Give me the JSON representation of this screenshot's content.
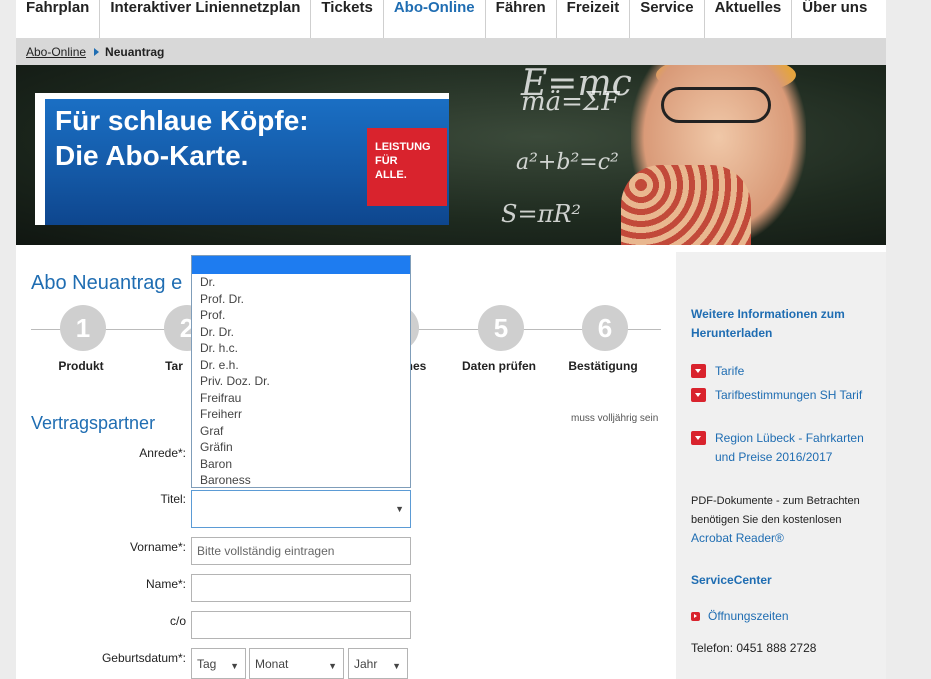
{
  "nav": {
    "items": [
      "Fahrplan",
      "Interaktiver Liniennetzplan",
      "Tickets",
      "Abo-Online",
      "Fähren",
      "Freizeit",
      "Service",
      "Aktuelles",
      "Über uns"
    ],
    "active": "Abo-Online"
  },
  "breadcrumb": {
    "link": "Abo-Online",
    "current": "Neuantrag"
  },
  "banner": {
    "line1": "Für schlaue Köpfe:",
    "line2": "Die Abo-Karte.",
    "badge": [
      "LEISTUNG",
      "FÜR",
      "ALLE."
    ],
    "chalk": [
      "E=mc",
      "mä=ΣF",
      "a²+b²=c²",
      "S=πR²"
    ]
  },
  "main": {
    "title": "Abo Neuantrag e",
    "steps": [
      {
        "num": "1",
        "label": "Produkt"
      },
      {
        "num": "2",
        "label": "Tar"
      },
      {
        "num": "4",
        "label": "nes"
      },
      {
        "num": "5",
        "label": "Daten prüfen"
      },
      {
        "num": "6",
        "label": "Bestätigung"
      }
    ],
    "section": "Vertragspartner",
    "note": "muss volljährig sein",
    "form": {
      "anrede_label": "Anrede*:",
      "titel_label": "Titel:",
      "vorname_label": "Vorname*:",
      "vorname_placeholder": "Bitte vollständig eintragen",
      "name_label": "Name*:",
      "co_label": "c/o",
      "geburt_label": "Geburtsdatum*:",
      "tag": "Tag",
      "monat": "Monat",
      "jahr": "Jahr"
    },
    "titel_options": [
      "Dr.",
      "Prof. Dr.",
      "Prof.",
      "Dr. Dr.",
      "Dr. h.c.",
      "Dr. e.h.",
      "Priv. Doz. Dr.",
      "Freifrau",
      "Freiherr",
      "Graf",
      "Gräfin",
      "Baron",
      "Baroness"
    ]
  },
  "sidebar": {
    "head1": "Weitere Informationen zum Herunterladen",
    "links": [
      "Tarife",
      "Tarifbestimmungen SH Tarif",
      "Region Lübeck - Fahrkarten und Preise 2016/2017"
    ],
    "pdf_note": "PDF-Dokumente - zum Betrachten benötigen Sie den kostenlosen",
    "acrobat": "Acrobat Reader®",
    "head2": "ServiceCenter",
    "opening": "Öffnungszeiten",
    "phone": "Telefon: 0451 888 2728"
  },
  "colors": {
    "accent": "#1f6db2",
    "red": "#d9232d",
    "selected": "#1e7cf0"
  }
}
